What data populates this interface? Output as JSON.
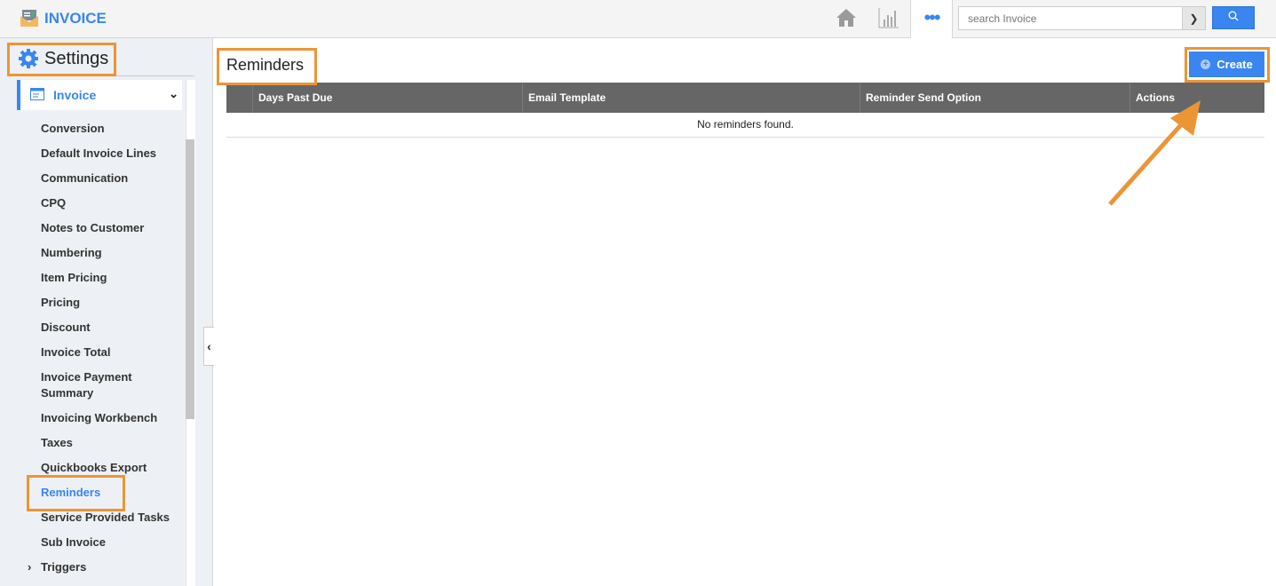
{
  "header": {
    "app_title": "INVOICE",
    "search_placeholder": "search Invoice"
  },
  "sidebar": {
    "title": "Settings",
    "section": "Invoice",
    "items": [
      "Conversion",
      "Default Invoice Lines",
      "Communication",
      "CPQ",
      "Notes to Customer",
      "Numbering",
      "Item Pricing",
      "Pricing",
      "Discount",
      "Invoice Total",
      "Invoice Payment Summary",
      "Invoicing Workbench",
      "Taxes",
      "Quickbooks Export",
      "Reminders",
      "Service Provided Tasks",
      "Sub Invoice",
      "Triggers"
    ],
    "active": "Reminders"
  },
  "main": {
    "title": "Reminders",
    "create_label": "Create",
    "columns": [
      "",
      "Days Past Due",
      "Email Template",
      "Reminder Send Option",
      "Actions"
    ],
    "empty_text": "No reminders found."
  },
  "colors": {
    "accent": "#3a86f0",
    "annotation": "#ec9535",
    "table_header": "#666666"
  }
}
